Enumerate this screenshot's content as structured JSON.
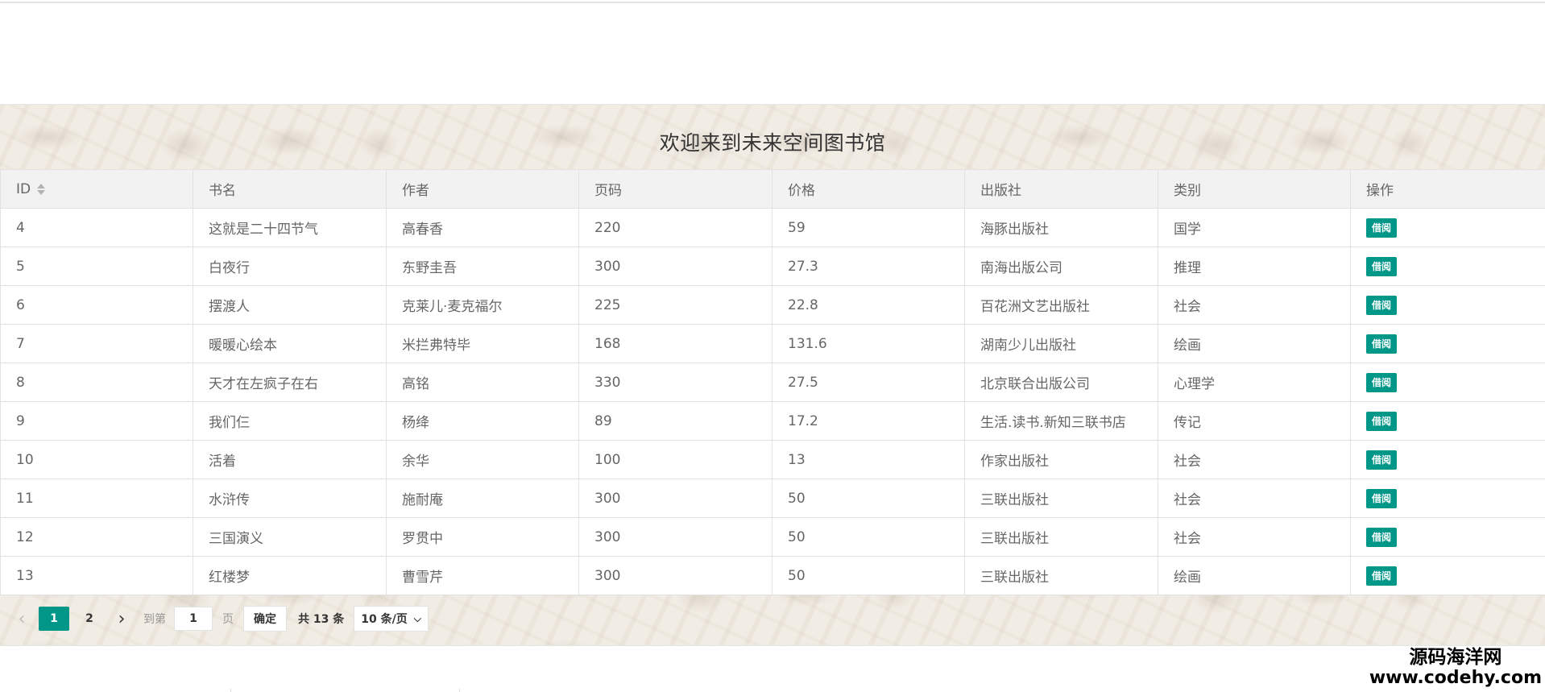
{
  "title": "欢迎来到未来空间图书馆",
  "table": {
    "columns": [
      "ID",
      "书名",
      "作者",
      "页码",
      "价格",
      "出版社",
      "类别",
      "操作"
    ],
    "action_label": "借阅",
    "rows": [
      {
        "id": "4",
        "name": "这就是二十四节气",
        "author": "高春香",
        "pages": "220",
        "price": "59",
        "publisher": "海豚出版社",
        "category": "国学"
      },
      {
        "id": "5",
        "name": "白夜行",
        "author": "东野圭吾",
        "pages": "300",
        "price": "27.3",
        "publisher": "南海出版公司",
        "category": "推理"
      },
      {
        "id": "6",
        "name": "摆渡人",
        "author": "克莱儿·麦克福尔",
        "pages": "225",
        "price": "22.8",
        "publisher": "百花洲文艺出版社",
        "category": "社会"
      },
      {
        "id": "7",
        "name": "暖暖心绘本",
        "author": "米拦弗特毕",
        "pages": "168",
        "price": "131.6",
        "publisher": "湖南少儿出版社",
        "category": "绘画"
      },
      {
        "id": "8",
        "name": "天才在左疯子在右",
        "author": "高铭",
        "pages": "330",
        "price": "27.5",
        "publisher": "北京联合出版公司",
        "category": "心理学"
      },
      {
        "id": "9",
        "name": "我们仨",
        "author": "杨绛",
        "pages": "89",
        "price": "17.2",
        "publisher": "生活.读书.新知三联书店",
        "category": "传记"
      },
      {
        "id": "10",
        "name": "活着",
        "author": "余华",
        "pages": "100",
        "price": "13",
        "publisher": "作家出版社",
        "category": "社会"
      },
      {
        "id": "11",
        "name": "水浒传",
        "author": "施耐庵",
        "pages": "300",
        "price": "50",
        "publisher": "三联出版社",
        "category": "社会"
      },
      {
        "id": "12",
        "name": "三国演义",
        "author": "罗贯中",
        "pages": "300",
        "price": "50",
        "publisher": "三联出版社",
        "category": "社会"
      },
      {
        "id": "13",
        "name": "红楼梦",
        "author": "曹雪芹",
        "pages": "300",
        "price": "50",
        "publisher": "三联出版社",
        "category": "绘画"
      }
    ]
  },
  "pagination": {
    "prev_icon": "chevron-left-icon",
    "next_icon": "chevron-right-icon",
    "pages": [
      "1",
      "2"
    ],
    "current_page": "1",
    "goto_label": "到第",
    "goto_value": "1",
    "page_unit": "页",
    "confirm_label": "确定",
    "total_label": "共 13 条",
    "page_size_label": "10 条/页"
  },
  "watermark": {
    "cn": "源码海洋网",
    "url": "www.codehy.com"
  },
  "colors": {
    "accent": "#009688",
    "header_bg": "#f2f2f2",
    "border": "#e2e2e2"
  }
}
